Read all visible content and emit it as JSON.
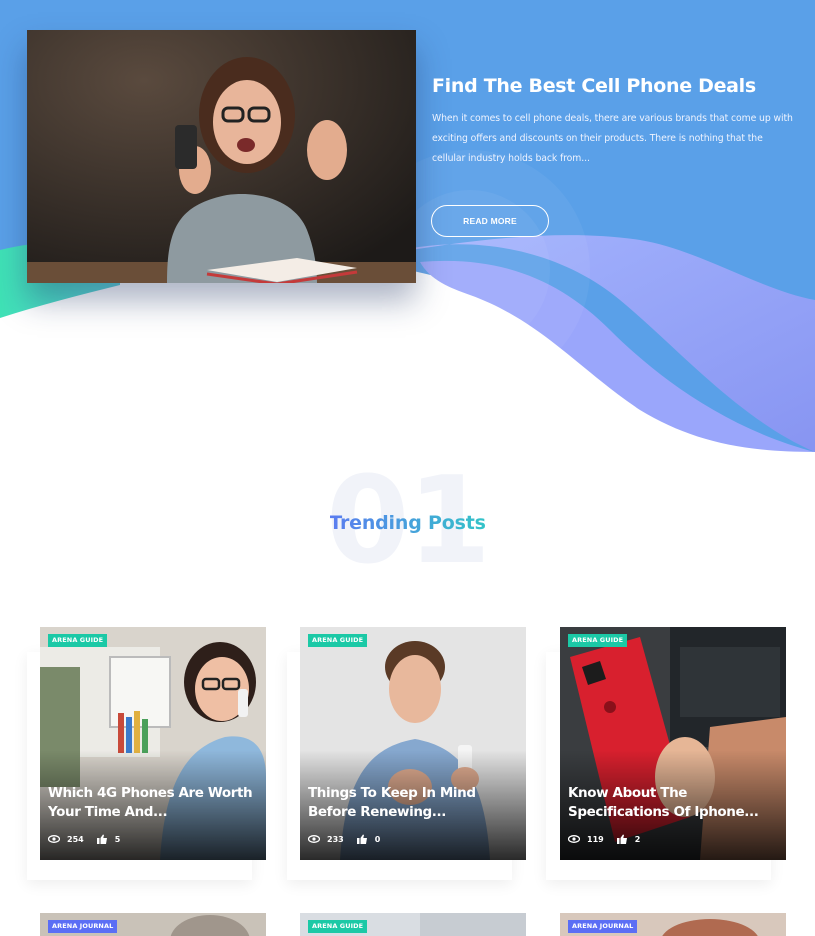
{
  "hero": {
    "title": "Find The Best Cell Phone Deals",
    "excerpt": "When it comes to cell phone deals, there are various brands that come up with exciting offers and discounts on their products. There is nothing that the cellular industry holds back from...",
    "button_label": "READ MORE",
    "colors": {
      "sky": "#5aa0e8",
      "wave_purple": "#8f9cf7",
      "wave_green": "#3ee0b8"
    }
  },
  "trending": {
    "number": "01",
    "title": "Trending Posts",
    "colors": {
      "title_start": "#5b7cf0",
      "title_end": "#33c4c8"
    }
  },
  "posts": [
    {
      "tag": "ARENA GUIDE",
      "title": "Which 4G Phones Are Worth Your Time And...",
      "views": "254",
      "likes": "5"
    },
    {
      "tag": "ARENA GUIDE",
      "title": "Things To Keep In Mind Before Renewing...",
      "views": "233",
      "likes": "0"
    },
    {
      "tag": "ARENA GUIDE",
      "title": "Know About The Specifications Of Iphone...",
      "views": "119",
      "likes": "2"
    }
  ],
  "next_posts": [
    {
      "tag": "ARENA JOURNAL"
    },
    {
      "tag": "ARENA GUIDE"
    },
    {
      "tag": "ARENA JOURNAL"
    }
  ],
  "icons": {
    "views": "eye-icon",
    "likes": "thumbs-up-icon"
  }
}
